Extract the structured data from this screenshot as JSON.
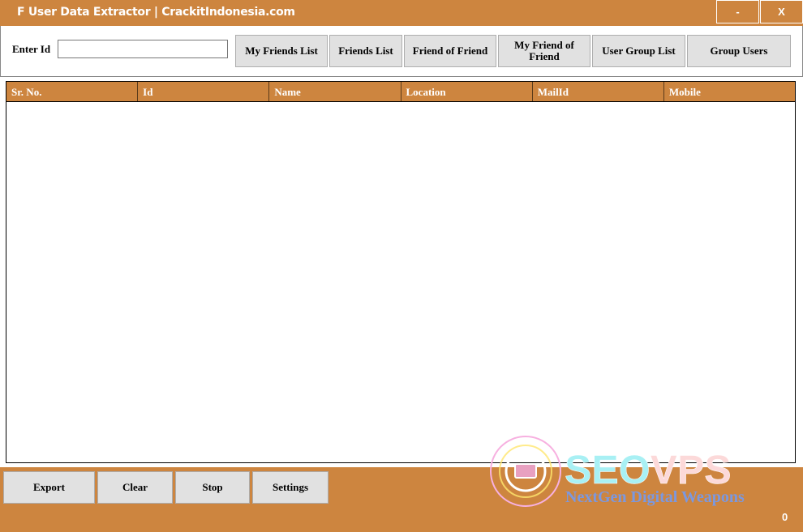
{
  "window": {
    "title": "F User Data Extractor | CrackitIndonesia.com",
    "minimize_label": "-",
    "close_label": "X"
  },
  "toolbar": {
    "enter_id_label": "Enter Id",
    "id_value": "",
    "buttons": [
      "My Friends List",
      "Friends List",
      "Friend of Friend",
      "My Friend of Friend",
      "User Group List",
      "Group Users"
    ]
  },
  "grid": {
    "columns": [
      "Sr. No.",
      "Id",
      "Name",
      "Location",
      "MailId",
      "Mobile"
    ],
    "rows": []
  },
  "footer": {
    "buttons": [
      "Export",
      "Clear",
      "Stop",
      "Settings"
    ],
    "count": "0"
  },
  "watermark": {
    "brand": "SEOVPS",
    "tagline": "NextGen Digital Weapons"
  },
  "colors": {
    "accent": "#CD853F",
    "button": "#E1E1E1"
  }
}
